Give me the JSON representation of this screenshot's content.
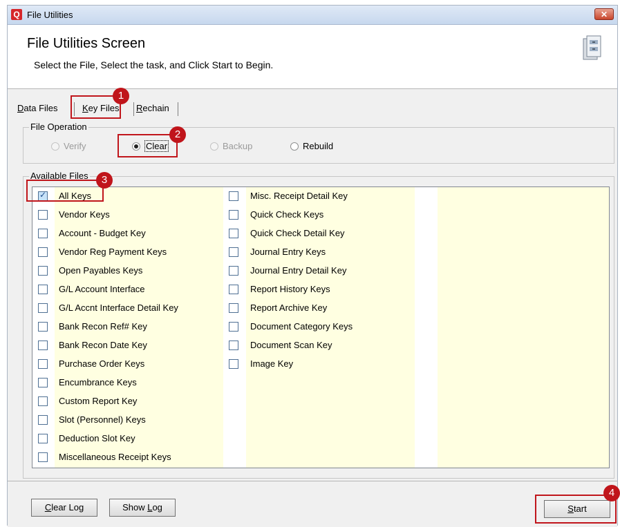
{
  "window": {
    "title": "File Utilities",
    "app_icon_letter": "Q",
    "close_glyph": "✕"
  },
  "header": {
    "title": "File Utilities Screen",
    "subtitle": "Select the File, Select the task, and Click Start to Begin."
  },
  "tabs": [
    {
      "label": "Data Files",
      "mnemonic": "D",
      "rest": "ata Files",
      "active": false
    },
    {
      "label": "Key Files",
      "mnemonic": "K",
      "rest": "ey Files",
      "active": true
    },
    {
      "label": "Rechain",
      "mnemonic": "R",
      "rest": "echain",
      "active": false
    }
  ],
  "file_operation": {
    "label": "File Operation",
    "options": [
      {
        "label": "Verify",
        "enabled": false,
        "checked": false
      },
      {
        "label": "Clear",
        "enabled": true,
        "checked": true
      },
      {
        "label": "Backup",
        "enabled": false,
        "checked": false
      },
      {
        "label": "Rebuild",
        "enabled": true,
        "checked": false
      }
    ]
  },
  "available_files": {
    "label": "Available Files",
    "column1": [
      {
        "label": "All Keys",
        "checked": true
      },
      {
        "label": "Vendor Keys",
        "checked": false
      },
      {
        "label": "Account - Budget Key",
        "checked": false
      },
      {
        "label": "Vendor Reg Payment Keys",
        "checked": false
      },
      {
        "label": "Open Payables Keys",
        "checked": false
      },
      {
        "label": "G/L Account Interface",
        "checked": false
      },
      {
        "label": "G/L Accnt Interface Detail Key",
        "checked": false
      },
      {
        "label": "Bank Recon Ref# Key",
        "checked": false
      },
      {
        "label": "Bank Recon Date Key",
        "checked": false
      },
      {
        "label": "Purchase Order Keys",
        "checked": false
      },
      {
        "label": "Encumbrance Keys",
        "checked": false
      },
      {
        "label": "Custom Report Key",
        "checked": false
      },
      {
        "label": "Slot (Personnel) Keys",
        "checked": false
      },
      {
        "label": "Deduction Slot Key",
        "checked": false
      },
      {
        "label": "Miscellaneous Receipt Keys",
        "checked": false
      }
    ],
    "column2": [
      {
        "label": "Misc. Receipt Detail Key",
        "checked": false
      },
      {
        "label": "Quick Check Keys",
        "checked": false
      },
      {
        "label": "Quick Check Detail Key",
        "checked": false
      },
      {
        "label": "Journal Entry Keys",
        "checked": false
      },
      {
        "label": "Journal Entry Detail Key",
        "checked": false
      },
      {
        "label": "Report History Keys",
        "checked": false
      },
      {
        "label": "Report Archive Key",
        "checked": false
      },
      {
        "label": "Document Category Keys",
        "checked": false
      },
      {
        "label": "Document Scan Key",
        "checked": false
      },
      {
        "label": "Image Key",
        "checked": false
      }
    ]
  },
  "buttons": {
    "clear_log": {
      "mnemonic": "C",
      "rest": "lear Log"
    },
    "show_log": {
      "pre": "Show ",
      "mnemonic": "L",
      "rest": "og"
    },
    "start": {
      "mnemonic": "S",
      "rest": "tart"
    }
  },
  "annotations": [
    "1",
    "2",
    "3",
    "4"
  ],
  "colors": {
    "annotation": "#c0151b",
    "list_highlight": "#ffffe1"
  }
}
